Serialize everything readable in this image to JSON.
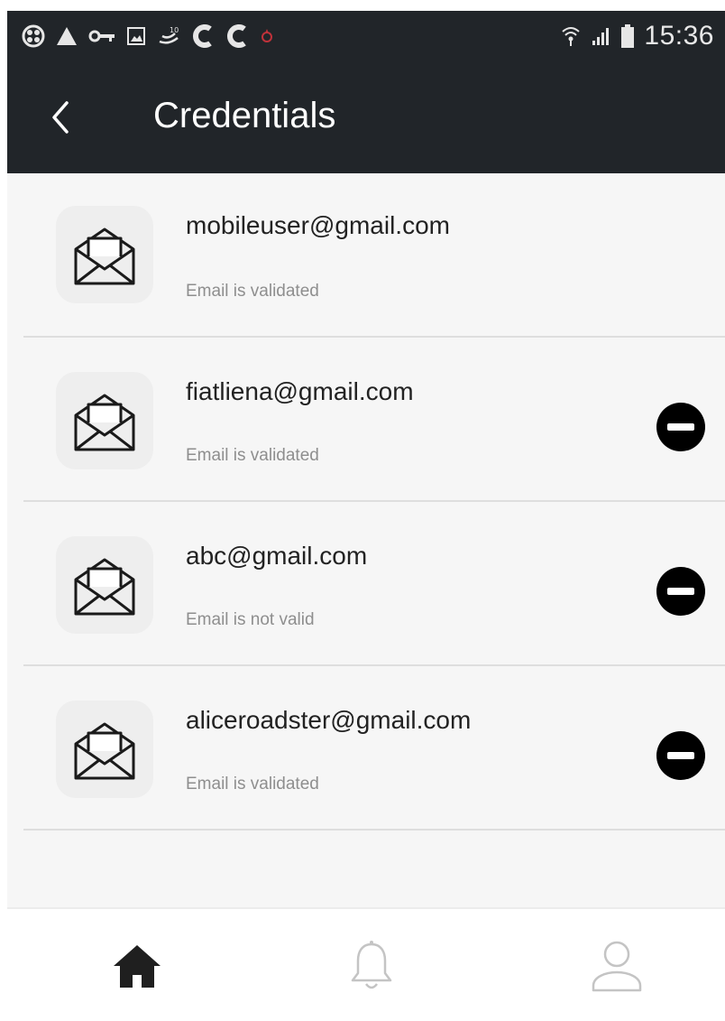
{
  "status_bar": {
    "time": "15:36",
    "icons": [
      "app-icon",
      "warning-icon",
      "vpn-key-icon",
      "image-icon",
      "usb-icon",
      "c-icon",
      "c-icon",
      "notification-dot-icon",
      "wifi-icon",
      "signal-icon",
      "battery-icon"
    ]
  },
  "app_bar": {
    "title": "Credentials",
    "back_icon": "back-chevron-icon"
  },
  "credentials": [
    {
      "email": "mobileuser@gmail.com",
      "status": "Email is validated",
      "removable": false
    },
    {
      "email": "fiatliena@gmail.com",
      "status": "Email is validated",
      "removable": true
    },
    {
      "email": "abc@gmail.com",
      "status": "Email is not valid",
      "removable": true
    },
    {
      "email": "aliceroadster@gmail.com",
      "status": "Email is validated",
      "removable": true
    }
  ],
  "bottom_nav": {
    "items": [
      {
        "icon": "home-icon",
        "active": true
      },
      {
        "icon": "bell-icon",
        "active": false
      },
      {
        "icon": "user-icon",
        "active": false
      }
    ]
  },
  "colors": {
    "bar": "#212529",
    "background": "#f6f6f6",
    "active_nav": "#1f1f1f",
    "inactive_nav": "#c4c4c4"
  }
}
